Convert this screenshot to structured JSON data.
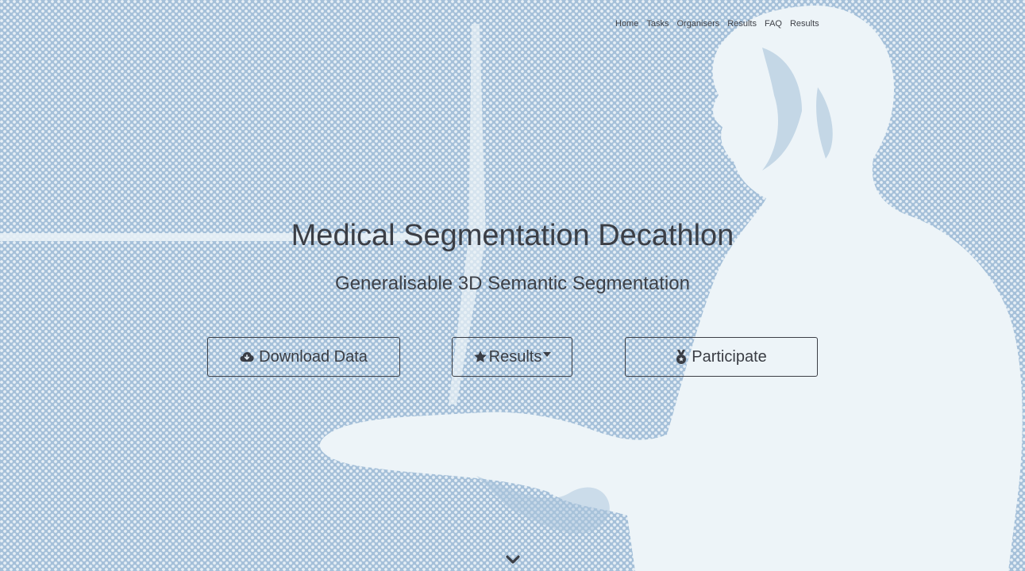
{
  "nav": {
    "items": [
      {
        "label": "Home"
      },
      {
        "label": "Tasks"
      },
      {
        "label": "Organisers"
      },
      {
        "label": "Results"
      },
      {
        "label": "FAQ"
      },
      {
        "label": "Results"
      }
    ]
  },
  "hero": {
    "title": "Medical Segmentation Decathlon",
    "subtitle": "Generalisable 3D Semantic Segmentation"
  },
  "buttons": {
    "download": {
      "label": "Download Data",
      "icon": "cloud-download-icon"
    },
    "results": {
      "label": "Results",
      "icon": "star-icon"
    },
    "participate": {
      "label": "Participate",
      "icon": "medal-icon"
    }
  },
  "scroll": {
    "icon": "chevron-down-icon"
  },
  "colors": {
    "background": "#a7c2da",
    "dot_light": "#edf4f8",
    "text": "#3b3e45"
  }
}
